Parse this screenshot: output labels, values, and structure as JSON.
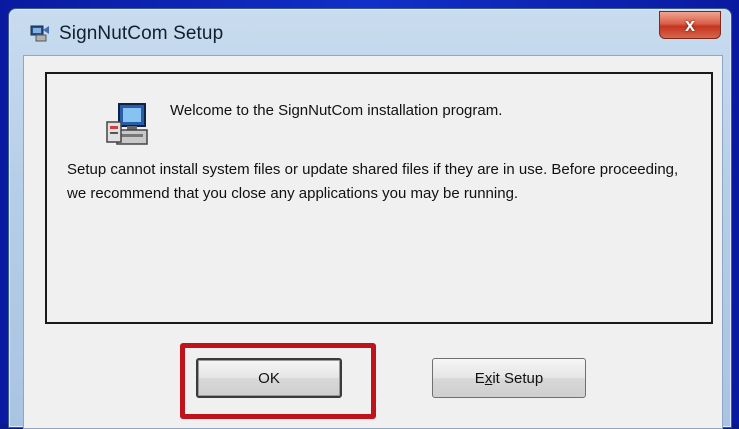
{
  "window": {
    "title": "SignNutCom Setup",
    "close_label": "x"
  },
  "content": {
    "welcome": "Welcome to the SignNutCom installation program.",
    "warning": "Setup cannot install system files or update shared files if they are in use. Before proceeding, we recommend that you close any applications you may be running."
  },
  "buttons": {
    "ok_label": "OK",
    "exit_pre": "E",
    "exit_underline": "x",
    "exit_post": "it Setup"
  },
  "annotation": {
    "highlight_color": "#c0121a"
  },
  "icons": {
    "app": "setup-app-icon",
    "install": "installer-computer-icon",
    "close": "close-icon"
  }
}
